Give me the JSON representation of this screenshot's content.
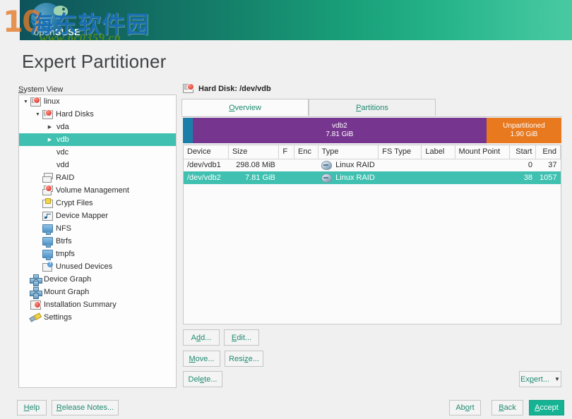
{
  "banner": {
    "logo_text_open": "open",
    "logo_text_suse": "SUSE",
    "watermark_cn": "海东软件园",
    "watermark_url": "www.pc0359.cn",
    "watermark_num": "10"
  },
  "page": {
    "title": "Expert Partitioner"
  },
  "sidebar": {
    "label": "System View",
    "items": [
      {
        "label": "linux",
        "icon": "disk-red-icon",
        "indent": 0,
        "twisty": "down",
        "selected": false
      },
      {
        "label": "Hard Disks",
        "icon": "disk-red-icon",
        "indent": 1,
        "twisty": "down",
        "selected": false
      },
      {
        "label": "vda",
        "icon": "none",
        "indent": 2,
        "twisty": "right",
        "selected": false
      },
      {
        "label": "vdb",
        "icon": "none",
        "indent": 2,
        "twisty": "right",
        "selected": true
      },
      {
        "label": "vdc",
        "icon": "none",
        "indent": 2,
        "twisty": "none",
        "selected": false
      },
      {
        "label": "vdd",
        "icon": "none",
        "indent": 2,
        "twisty": "none",
        "selected": false
      },
      {
        "label": "RAID",
        "icon": "raid-icon",
        "indent": 1,
        "twisty": "none",
        "selected": false
      },
      {
        "label": "Volume Management",
        "icon": "volume-icon",
        "indent": 1,
        "twisty": "none",
        "selected": false
      },
      {
        "label": "Crypt Files",
        "icon": "crypt-icon",
        "indent": 1,
        "twisty": "none",
        "selected": false
      },
      {
        "label": "Device Mapper",
        "icon": "device-mapper-icon",
        "indent": 1,
        "twisty": "none",
        "selected": false
      },
      {
        "label": "NFS",
        "icon": "monitor-icon",
        "indent": 1,
        "twisty": "none",
        "selected": false
      },
      {
        "label": "Btrfs",
        "icon": "monitor-icon",
        "indent": 1,
        "twisty": "none",
        "selected": false
      },
      {
        "label": "tmpfs",
        "icon": "monitor-icon",
        "indent": 1,
        "twisty": "none",
        "selected": false
      },
      {
        "label": "Unused Devices",
        "icon": "unused-devices-icon",
        "indent": 1,
        "twisty": "none",
        "selected": false
      },
      {
        "label": "Device Graph",
        "icon": "graph-icon",
        "indent": 0,
        "twisty": "none",
        "selected": false
      },
      {
        "label": "Mount Graph",
        "icon": "graph-icon",
        "indent": 0,
        "twisty": "none",
        "selected": false
      },
      {
        "label": "Installation Summary",
        "icon": "summary-icon",
        "indent": 0,
        "twisty": "none",
        "selected": false
      },
      {
        "label": "Settings",
        "icon": "wrench-icon",
        "indent": 0,
        "twisty": "none",
        "selected": false
      }
    ]
  },
  "main": {
    "header_title": "Hard Disk: /dev/vdb",
    "header_icon": "hard-disk-icon",
    "tabs": [
      {
        "label": "Overview",
        "hotkey": "O",
        "active": true
      },
      {
        "label": "Partitions",
        "hotkey": "P",
        "active": false
      }
    ],
    "partition_bar": {
      "segments": [
        {
          "name": "",
          "size": "",
          "color": "#1a7fa8",
          "width_pct": 2.6
        },
        {
          "name": "vdb2",
          "size": "7.81 GiB",
          "color": "#76358f",
          "width_pct": 77.6
        },
        {
          "name": "Unpartitioned",
          "size": "1.90 GiB",
          "color": "#e8791f",
          "width_pct": 19.8
        }
      ]
    },
    "table": {
      "columns": [
        "Device",
        "Size",
        "F",
        "Enc",
        "Type",
        "FS Type",
        "Label",
        "Mount Point",
        "Start",
        "End"
      ],
      "rows": [
        {
          "device": "/dev/vdb1",
          "size": "298.08 MiB",
          "f": "",
          "enc": "",
          "type": "Linux RAID",
          "fstype": "",
          "label": "",
          "mountpoint": "",
          "start": "0",
          "end": "37",
          "selected": false
        },
        {
          "device": "/dev/vdb2",
          "size": "7.81 GiB",
          "f": "",
          "enc": "",
          "type": "Linux RAID",
          "fstype": "",
          "label": "",
          "mountpoint": "",
          "start": "38",
          "end": "1057",
          "selected": true
        }
      ]
    },
    "buttons": {
      "add": "Add...",
      "add_hotkey": "d",
      "edit": "Edit...",
      "edit_hotkey": "E",
      "move": "Move...",
      "move_hotkey": "M",
      "resize": "Resize...",
      "resize_hotkey": "z",
      "delete": "Delete...",
      "delete_hotkey": "e",
      "expert": "Expert...",
      "expert_hotkey": "p"
    }
  },
  "footer": {
    "help": "Help",
    "help_hotkey": "H",
    "release_notes": "Release Notes...",
    "release_notes_hotkey": "R",
    "abort": "Abort",
    "abort_hotkey": "o",
    "back": "Back",
    "back_hotkey": "B",
    "accept": "Accept",
    "accept_hotkey": "A"
  },
  "colors": {
    "accent_teal": "#15b394",
    "selection_teal": "#3fc0b0",
    "partition_purple": "#76358f",
    "partition_orange": "#e8791f",
    "partition_blue": "#1a7fa8",
    "link_green": "#1f8a70"
  }
}
